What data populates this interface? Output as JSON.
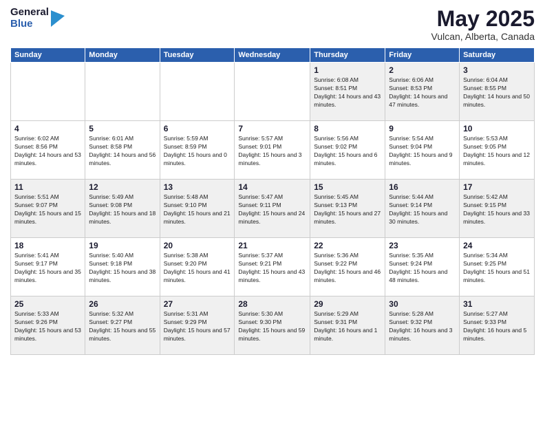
{
  "header": {
    "logo": {
      "general": "General",
      "blue": "Blue"
    },
    "title": "May 2025",
    "location": "Vulcan, Alberta, Canada"
  },
  "weekdays": [
    "Sunday",
    "Monday",
    "Tuesday",
    "Wednesday",
    "Thursday",
    "Friday",
    "Saturday"
  ],
  "weeks": [
    [
      {
        "day": "",
        "sunrise": "",
        "sunset": "",
        "daylight": ""
      },
      {
        "day": "",
        "sunrise": "",
        "sunset": "",
        "daylight": ""
      },
      {
        "day": "",
        "sunrise": "",
        "sunset": "",
        "daylight": ""
      },
      {
        "day": "",
        "sunrise": "",
        "sunset": "",
        "daylight": ""
      },
      {
        "day": "1",
        "sunrise": "Sunrise: 6:08 AM",
        "sunset": "Sunset: 8:51 PM",
        "daylight": "Daylight: 14 hours and 43 minutes."
      },
      {
        "day": "2",
        "sunrise": "Sunrise: 6:06 AM",
        "sunset": "Sunset: 8:53 PM",
        "daylight": "Daylight: 14 hours and 47 minutes."
      },
      {
        "day": "3",
        "sunrise": "Sunrise: 6:04 AM",
        "sunset": "Sunset: 8:55 PM",
        "daylight": "Daylight: 14 hours and 50 minutes."
      }
    ],
    [
      {
        "day": "4",
        "sunrise": "Sunrise: 6:02 AM",
        "sunset": "Sunset: 8:56 PM",
        "daylight": "Daylight: 14 hours and 53 minutes."
      },
      {
        "day": "5",
        "sunrise": "Sunrise: 6:01 AM",
        "sunset": "Sunset: 8:58 PM",
        "daylight": "Daylight: 14 hours and 56 minutes."
      },
      {
        "day": "6",
        "sunrise": "Sunrise: 5:59 AM",
        "sunset": "Sunset: 8:59 PM",
        "daylight": "Daylight: 15 hours and 0 minutes."
      },
      {
        "day": "7",
        "sunrise": "Sunrise: 5:57 AM",
        "sunset": "Sunset: 9:01 PM",
        "daylight": "Daylight: 15 hours and 3 minutes."
      },
      {
        "day": "8",
        "sunrise": "Sunrise: 5:56 AM",
        "sunset": "Sunset: 9:02 PM",
        "daylight": "Daylight: 15 hours and 6 minutes."
      },
      {
        "day": "9",
        "sunrise": "Sunrise: 5:54 AM",
        "sunset": "Sunset: 9:04 PM",
        "daylight": "Daylight: 15 hours and 9 minutes."
      },
      {
        "day": "10",
        "sunrise": "Sunrise: 5:53 AM",
        "sunset": "Sunset: 9:05 PM",
        "daylight": "Daylight: 15 hours and 12 minutes."
      }
    ],
    [
      {
        "day": "11",
        "sunrise": "Sunrise: 5:51 AM",
        "sunset": "Sunset: 9:07 PM",
        "daylight": "Daylight: 15 hours and 15 minutes."
      },
      {
        "day": "12",
        "sunrise": "Sunrise: 5:49 AM",
        "sunset": "Sunset: 9:08 PM",
        "daylight": "Daylight: 15 hours and 18 minutes."
      },
      {
        "day": "13",
        "sunrise": "Sunrise: 5:48 AM",
        "sunset": "Sunset: 9:10 PM",
        "daylight": "Daylight: 15 hours and 21 minutes."
      },
      {
        "day": "14",
        "sunrise": "Sunrise: 5:47 AM",
        "sunset": "Sunset: 9:11 PM",
        "daylight": "Daylight: 15 hours and 24 minutes."
      },
      {
        "day": "15",
        "sunrise": "Sunrise: 5:45 AM",
        "sunset": "Sunset: 9:13 PM",
        "daylight": "Daylight: 15 hours and 27 minutes."
      },
      {
        "day": "16",
        "sunrise": "Sunrise: 5:44 AM",
        "sunset": "Sunset: 9:14 PM",
        "daylight": "Daylight: 15 hours and 30 minutes."
      },
      {
        "day": "17",
        "sunrise": "Sunrise: 5:42 AM",
        "sunset": "Sunset: 9:15 PM",
        "daylight": "Daylight: 15 hours and 33 minutes."
      }
    ],
    [
      {
        "day": "18",
        "sunrise": "Sunrise: 5:41 AM",
        "sunset": "Sunset: 9:17 PM",
        "daylight": "Daylight: 15 hours and 35 minutes."
      },
      {
        "day": "19",
        "sunrise": "Sunrise: 5:40 AM",
        "sunset": "Sunset: 9:18 PM",
        "daylight": "Daylight: 15 hours and 38 minutes."
      },
      {
        "day": "20",
        "sunrise": "Sunrise: 5:38 AM",
        "sunset": "Sunset: 9:20 PM",
        "daylight": "Daylight: 15 hours and 41 minutes."
      },
      {
        "day": "21",
        "sunrise": "Sunrise: 5:37 AM",
        "sunset": "Sunset: 9:21 PM",
        "daylight": "Daylight: 15 hours and 43 minutes."
      },
      {
        "day": "22",
        "sunrise": "Sunrise: 5:36 AM",
        "sunset": "Sunset: 9:22 PM",
        "daylight": "Daylight: 15 hours and 46 minutes."
      },
      {
        "day": "23",
        "sunrise": "Sunrise: 5:35 AM",
        "sunset": "Sunset: 9:24 PM",
        "daylight": "Daylight: 15 hours and 48 minutes."
      },
      {
        "day": "24",
        "sunrise": "Sunrise: 5:34 AM",
        "sunset": "Sunset: 9:25 PM",
        "daylight": "Daylight: 15 hours and 51 minutes."
      }
    ],
    [
      {
        "day": "25",
        "sunrise": "Sunrise: 5:33 AM",
        "sunset": "Sunset: 9:26 PM",
        "daylight": "Daylight: 15 hours and 53 minutes."
      },
      {
        "day": "26",
        "sunrise": "Sunrise: 5:32 AM",
        "sunset": "Sunset: 9:27 PM",
        "daylight": "Daylight: 15 hours and 55 minutes."
      },
      {
        "day": "27",
        "sunrise": "Sunrise: 5:31 AM",
        "sunset": "Sunset: 9:29 PM",
        "daylight": "Daylight: 15 hours and 57 minutes."
      },
      {
        "day": "28",
        "sunrise": "Sunrise: 5:30 AM",
        "sunset": "Sunset: 9:30 PM",
        "daylight": "Daylight: 15 hours and 59 minutes."
      },
      {
        "day": "29",
        "sunrise": "Sunrise: 5:29 AM",
        "sunset": "Sunset: 9:31 PM",
        "daylight": "Daylight: 16 hours and 1 minute."
      },
      {
        "day": "30",
        "sunrise": "Sunrise: 5:28 AM",
        "sunset": "Sunset: 9:32 PM",
        "daylight": "Daylight: 16 hours and 3 minutes."
      },
      {
        "day": "31",
        "sunrise": "Sunrise: 5:27 AM",
        "sunset": "Sunset: 9:33 PM",
        "daylight": "Daylight: 16 hours and 5 minutes."
      }
    ]
  ]
}
